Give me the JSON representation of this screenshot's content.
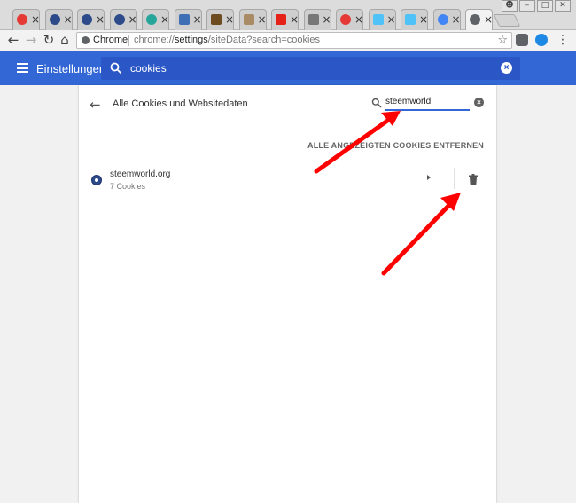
{
  "tabs": [
    {
      "icon": "red-circle-icon",
      "color": "#e53935"
    },
    {
      "icon": "w-globe-icon",
      "color": "#2d4a8a"
    },
    {
      "icon": "w-globe-icon",
      "color": "#2d4a8a"
    },
    {
      "icon": "w-globe-icon",
      "color": "#2d4a8a"
    },
    {
      "icon": "green-circle-icon",
      "color": "#26a69a"
    },
    {
      "icon": "blue-lines-icon",
      "color": "#3f6fb5"
    },
    {
      "icon": "brown-box-icon",
      "color": "#6d4c1f"
    },
    {
      "icon": "package-icon",
      "color": "#a98c65"
    },
    {
      "icon": "youtube-icon",
      "color": "#e62117"
    },
    {
      "icon": "image-icon",
      "color": "#777777"
    },
    {
      "icon": "red-circle-icon",
      "color": "#e53935"
    },
    {
      "icon": "cloud-icon",
      "color": "#4fc3f7"
    },
    {
      "icon": "cloud-icon",
      "color": "#4fc3f7"
    },
    {
      "icon": "google-icon",
      "color": "#4285f4"
    },
    {
      "icon": "gear-icon",
      "color": "#5f6368",
      "active": true
    }
  ],
  "toolbar": {
    "omnibox_label": "Chrome",
    "url_prefix": "chrome://",
    "url_host": "settings",
    "url_rest": "/siteData?search=cookies"
  },
  "header": {
    "title": "Einstellungen",
    "search_value": "cookies"
  },
  "page": {
    "title": "Alle Cookies und Websitedaten",
    "site_search_value": "steemworld",
    "remove_all_label": "ALLE ANGEZEIGTEN COOKIES ENTFERNEN"
  },
  "sites": [
    {
      "name": "steemworld.org",
      "count": "7 Cookies"
    }
  ],
  "colors": {
    "header_blue": "#3367d6",
    "search_bg": "#2a56c6",
    "arrow_red": "#ff0000"
  }
}
